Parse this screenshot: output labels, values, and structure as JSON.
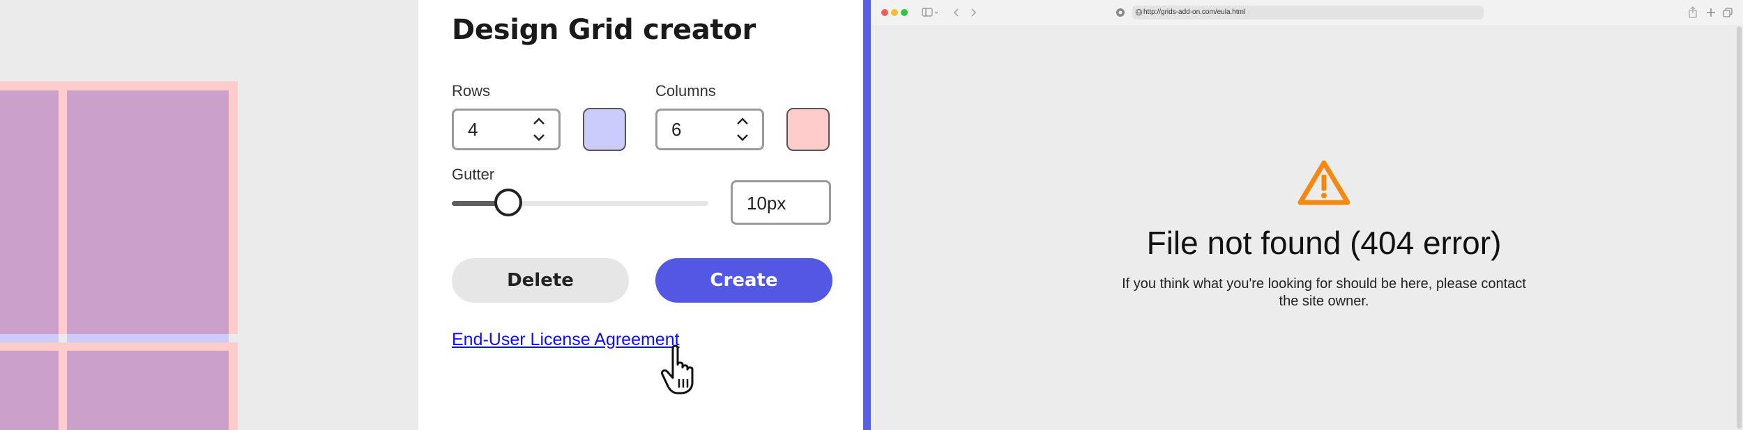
{
  "panel": {
    "title": "Design Grid creator",
    "rows": {
      "label": "Rows",
      "value": "4",
      "swatch_color": "#ccccfc"
    },
    "columns": {
      "label": "Columns",
      "value": "6",
      "swatch_color": "#ffcccc"
    },
    "gutter": {
      "label": "Gutter",
      "value": "10px",
      "slider_fraction": 0.22
    },
    "delete_label": "Delete",
    "create_label": "Create",
    "eula_link": "End-User License Agreement"
  },
  "browser": {
    "url": "http://grids-add-on.com/eula.html",
    "error_title": "File not found (404 error)",
    "error_message": "If you think what you're looking for should be here, please contact the site owner."
  },
  "colors": {
    "accent": "#5258e4",
    "row_band": "#ccccfc",
    "column_band": "#ffcccc",
    "grid_overlap": "#cba0cb",
    "warning": "#f28a12"
  }
}
